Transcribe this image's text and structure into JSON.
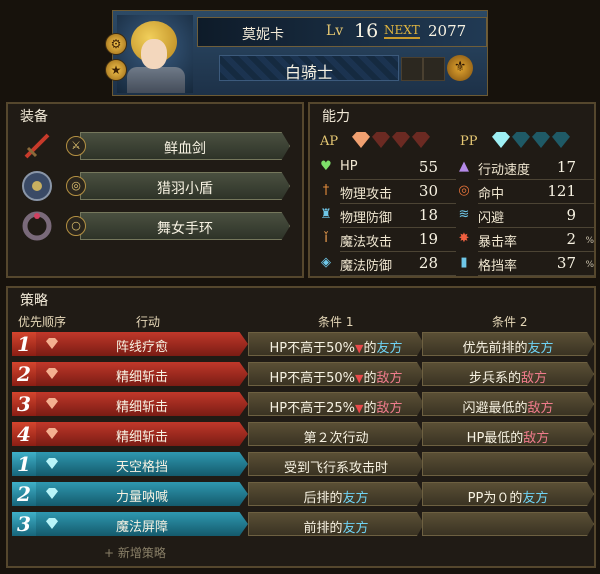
{
  "header": {
    "name": "莫妮卡",
    "lv_label": "Lv",
    "level": "16",
    "next_label": "NEXT",
    "next_value": "2077",
    "class_name": "白骑士"
  },
  "equipment": {
    "title": "装备",
    "items": [
      {
        "name": "鲜血剑",
        "icon": "sword-icon"
      },
      {
        "name": "猎羽小盾",
        "icon": "shield-icon"
      },
      {
        "name": "舞女手环",
        "icon": "ring-icon"
      }
    ]
  },
  "abilities": {
    "title": "能力",
    "ap_label": "AP",
    "pp_label": "PP",
    "ap_filled": 1,
    "ap_total": 4,
    "pp_filled": 1,
    "pp_total": 4,
    "left": [
      {
        "label": "HP",
        "value": "55",
        "icon": "heart-icon",
        "color": "#7ee06a"
      },
      {
        "label": "物理攻击",
        "value": "30",
        "icon": "sword-icon",
        "color": "#e08a3a"
      },
      {
        "label": "物理防御",
        "value": "18",
        "icon": "armor-icon",
        "color": "#6fc7e8"
      },
      {
        "label": "魔法攻击",
        "value": "19",
        "icon": "staff-icon",
        "color": "#f0a050"
      },
      {
        "label": "魔法防御",
        "value": "28",
        "icon": "magic-shield-icon",
        "color": "#6fc7e8"
      }
    ],
    "right": [
      {
        "label": "行动速度",
        "value": "17",
        "unit": "",
        "icon": "boot-icon",
        "color": "#b58ae8"
      },
      {
        "label": "命中",
        "value": "121",
        "unit": "",
        "icon": "target-icon",
        "color": "#e8743a"
      },
      {
        "label": "闪避",
        "value": "9",
        "unit": "",
        "icon": "evade-icon",
        "color": "#6fc7e8"
      },
      {
        "label": "暴击率",
        "value": "2",
        "unit": "%",
        "icon": "crit-icon",
        "color": "#f06040"
      },
      {
        "label": "格挡率",
        "value": "37",
        "unit": "%",
        "icon": "block-icon",
        "color": "#6fc7e8"
      }
    ]
  },
  "strategy": {
    "title": "策略",
    "columns": {
      "priority": "优先顺序",
      "action": "行动",
      "cond1": "条件 1",
      "cond2": "条件 2"
    },
    "add_label": "+ 新增策略",
    "rows": [
      {
        "prio": "1",
        "kind": "ap",
        "action": "阵线疗愈",
        "c1": [
          {
            "t": "HP不高于50%"
          },
          {
            "t": "▼",
            "c": "tri"
          },
          {
            "t": "的"
          },
          {
            "t": "友方",
            "c": "friend"
          }
        ],
        "c2": [
          {
            "t": "优先"
          },
          {
            "t": "前排的"
          },
          {
            "t": "友方",
            "c": "friend"
          }
        ]
      },
      {
        "prio": "2",
        "kind": "ap",
        "action": "精细斩击",
        "c1": [
          {
            "t": "HP不高于50%"
          },
          {
            "t": "▼",
            "c": "tri"
          },
          {
            "t": "的"
          },
          {
            "t": "敌方",
            "c": "enemy"
          }
        ],
        "c2": [
          {
            "t": "步兵系的"
          },
          {
            "t": "敌方",
            "c": "enemy"
          }
        ]
      },
      {
        "prio": "3",
        "kind": "ap",
        "action": "精细斩击",
        "c1": [
          {
            "t": "HP不高于25%"
          },
          {
            "t": "▼",
            "c": "tri"
          },
          {
            "t": "的"
          },
          {
            "t": "敌方",
            "c": "enemy"
          }
        ],
        "c2": [
          {
            "t": "闪避最低的"
          },
          {
            "t": "敌方",
            "c": "enemy"
          }
        ]
      },
      {
        "prio": "4",
        "kind": "ap",
        "action": "精细斩击",
        "c1": [
          {
            "t": "第２次行动"
          }
        ],
        "c2": [
          {
            "t": "HP最低的"
          },
          {
            "t": "敌方",
            "c": "enemy"
          }
        ]
      },
      {
        "prio": "1",
        "kind": "pp",
        "action": "天空格挡",
        "c1": [
          {
            "t": "受到飞行系攻击时"
          }
        ],
        "c2": []
      },
      {
        "prio": "2",
        "kind": "pp",
        "action": "力量呐喊",
        "c1": [
          {
            "t": "后排的"
          },
          {
            "t": "友方",
            "c": "friend"
          }
        ],
        "c2": [
          {
            "t": "PP为０的"
          },
          {
            "t": "友方",
            "c": "friend"
          }
        ]
      },
      {
        "prio": "3",
        "kind": "pp",
        "action": "魔法屏障",
        "c1": [
          {
            "t": "前排的"
          },
          {
            "t": "友方",
            "c": "friend"
          }
        ],
        "c2": []
      }
    ]
  },
  "colors": {
    "ap_red": "#b22a1e",
    "pp_blue": "#1f7f97",
    "friend": "#6fd3f4",
    "enemy": "#f07c8c",
    "gold": "#e6c873"
  }
}
